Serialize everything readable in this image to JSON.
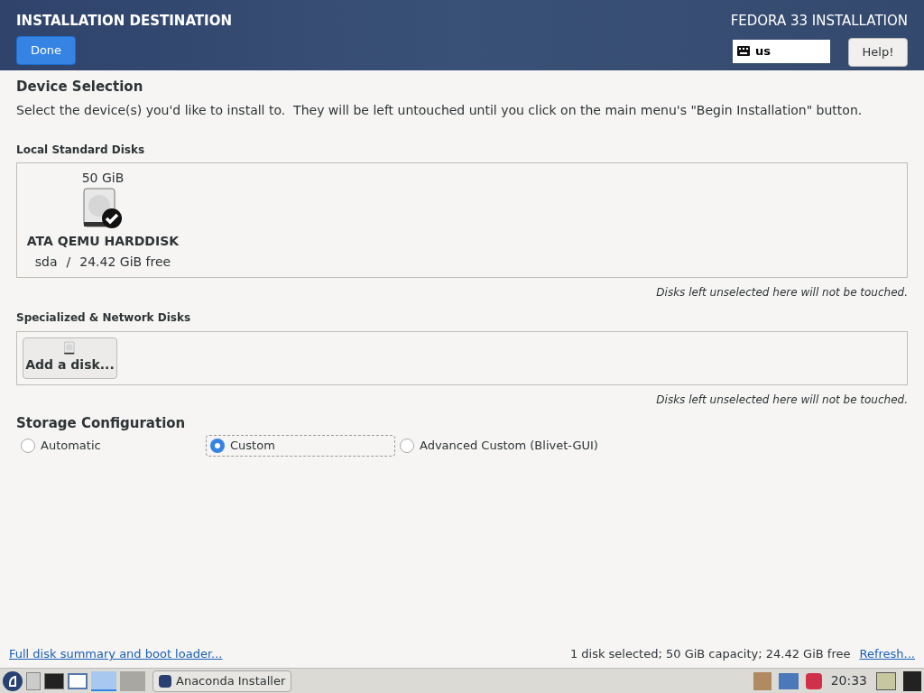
{
  "header": {
    "title": "INSTALLATION DESTINATION",
    "done_button": "Done",
    "product": "FEDORA 33 INSTALLATION",
    "keyboard_layout": "us",
    "help_button": "Help!"
  },
  "device_selection": {
    "heading": "Device Selection",
    "description": "Select the device(s) you'd like to install to.  They will be left untouched until you click on the main menu's \"Begin Installation\" button."
  },
  "local_disks": {
    "heading": "Local Standard Disks",
    "disks": [
      {
        "size": "50 GiB",
        "name": "ATA QEMU HARDDISK",
        "device": "sda",
        "separator": "/",
        "free": "24.42 GiB free",
        "selected": true
      }
    ],
    "note": "Disks left unselected here will not be touched."
  },
  "specialized_disks": {
    "heading": "Specialized & Network Disks",
    "add_button": "Add a disk...",
    "note": "Disks left unselected here will not be touched."
  },
  "storage_configuration": {
    "heading": "Storage Configuration",
    "options": [
      {
        "label": "Automatic",
        "selected": false
      },
      {
        "label": "Custom",
        "selected": true
      },
      {
        "label": "Advanced Custom (Blivet-GUI)",
        "selected": false
      }
    ]
  },
  "footer": {
    "link": "Full disk summary and boot loader...",
    "summary": "1 disk selected; 50 GiB capacity; 24.42 GiB free",
    "refresh_link": "Refresh..."
  },
  "taskbar": {
    "workspaces": [
      {
        "selected": true
      },
      {
        "selected": false
      }
    ],
    "task": "Anaconda Installer",
    "clock": "20:33"
  }
}
